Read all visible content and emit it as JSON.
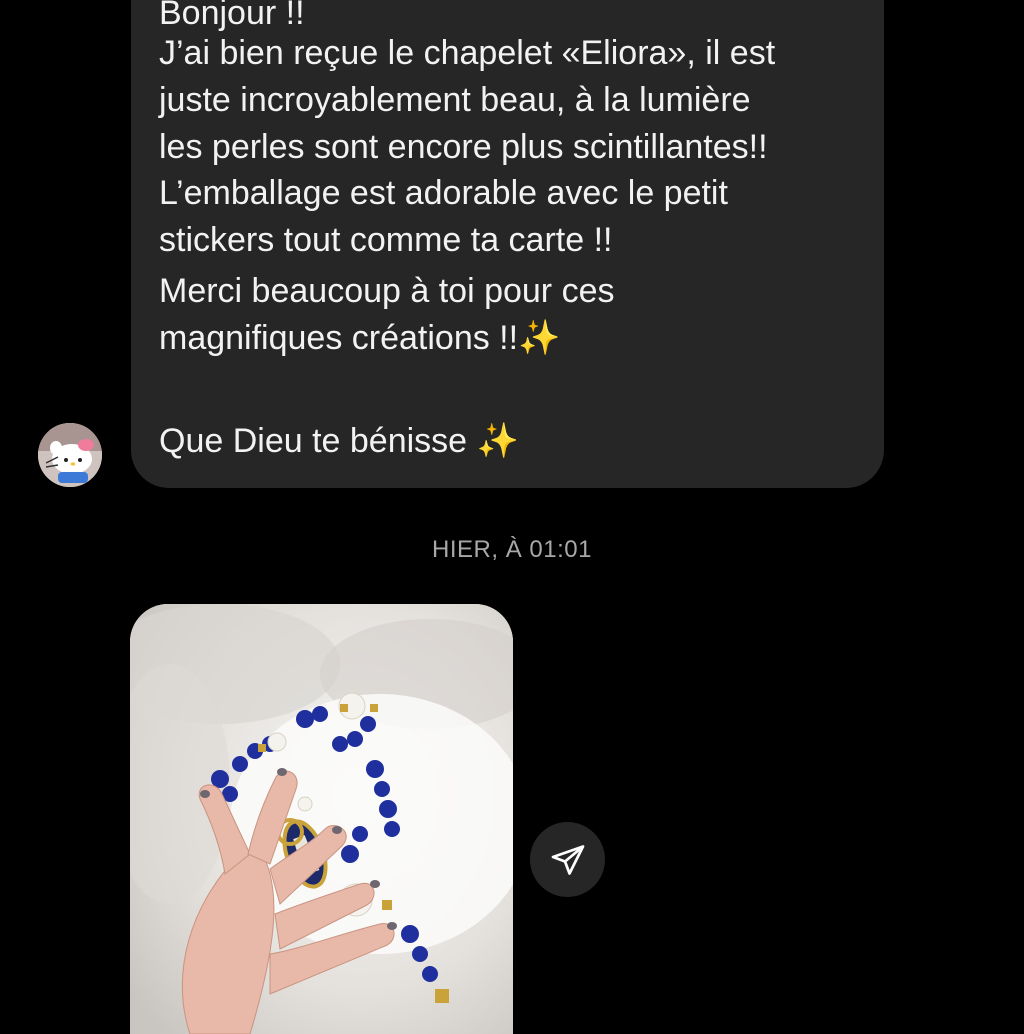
{
  "message": {
    "lines": [
      "Bonjour !!",
      "J’ai bien reçue le chapelet «Eliora», il est",
      "juste incroyablement beau, à la lumière",
      "les perles sont encore plus scintillantes!!",
      "L’emballage est adorable avec le petit",
      "stickers tout comme ta carte !!",
      "Merci beaucoup à toi pour ces",
      "magnifiques créations !!✨",
      "Que Dieu te bénisse ✨"
    ]
  },
  "timestamp": "HIER, À 01:01",
  "icons": {
    "avatar": "hello-kitty-avatar",
    "share": "paper-plane-icon"
  },
  "colors": {
    "background": "#000000",
    "bubble": "#262626",
    "text": "#f2f2f2",
    "timestamp": "#a8a8a8"
  }
}
